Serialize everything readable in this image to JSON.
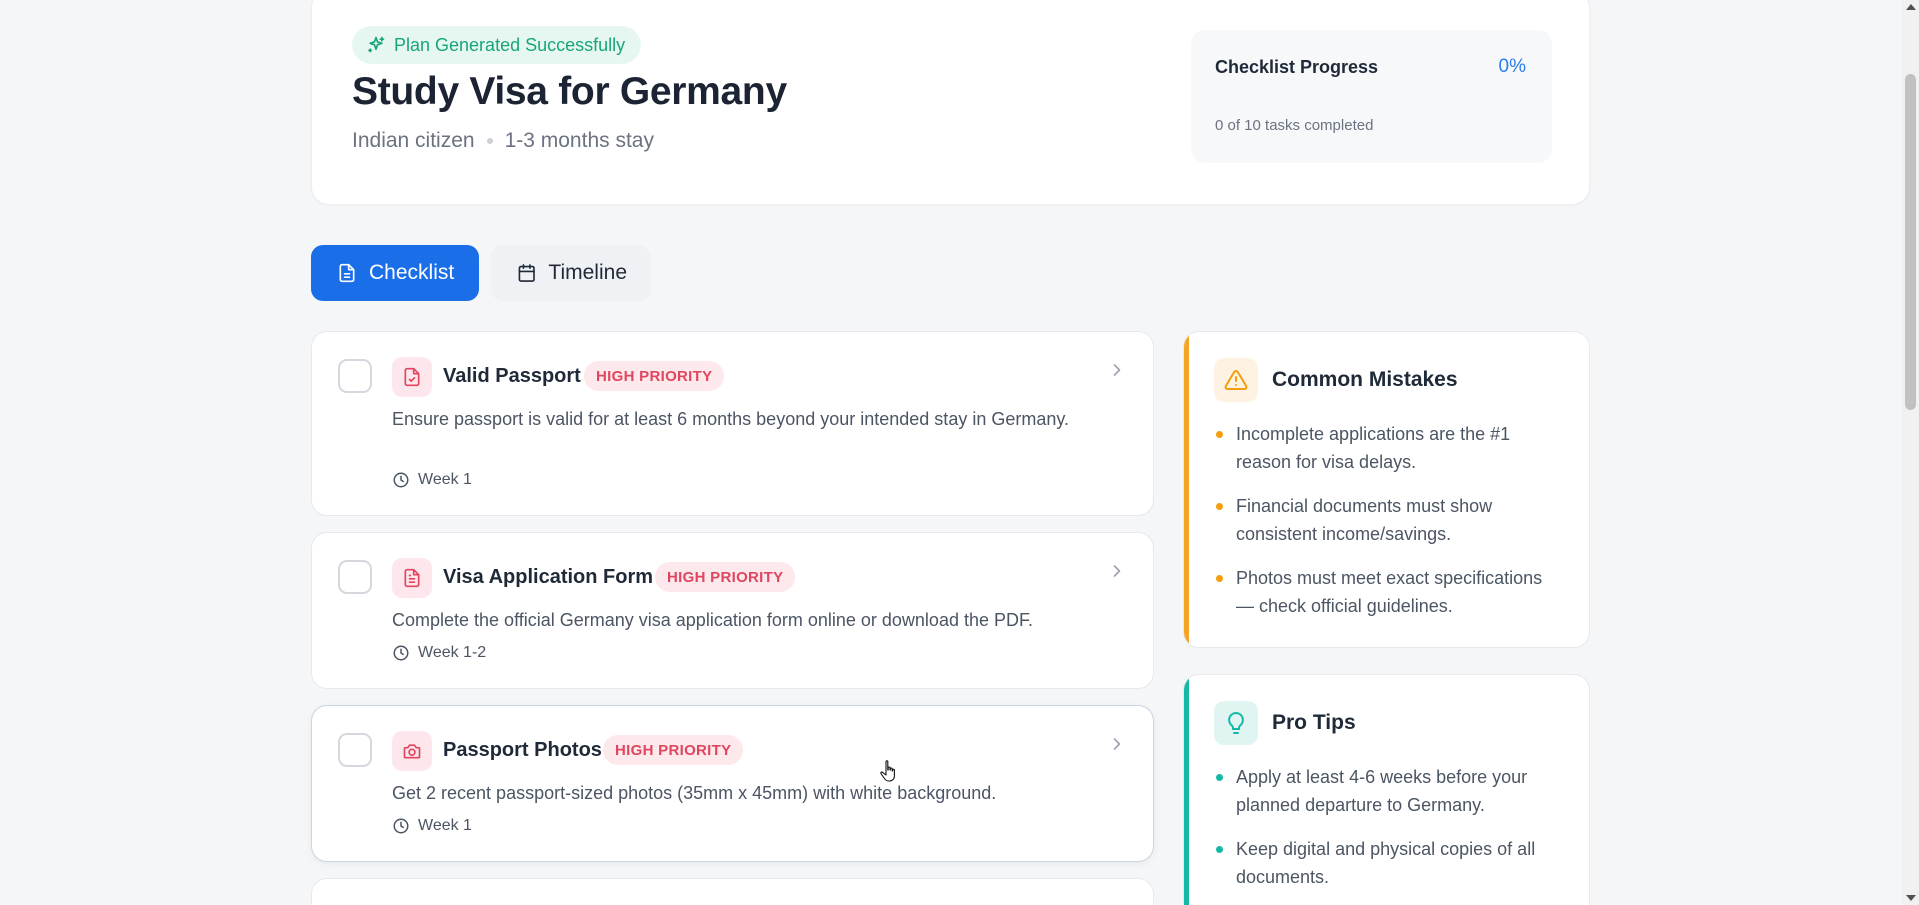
{
  "header": {
    "badge": "Plan Generated Successfully",
    "title": "Study Visa for Germany",
    "citizenship": "Indian citizen",
    "stay": "1-3 months stay",
    "progress": {
      "label": "Checklist Progress",
      "value_text": "0%",
      "percent": 0,
      "summary": "0 of 10 tasks completed"
    }
  },
  "tabs": [
    {
      "label": "Checklist",
      "icon": "document-icon",
      "active": true
    },
    {
      "label": "Timeline",
      "icon": "calendar-icon",
      "active": false
    }
  ],
  "checklist": [
    {
      "title": "Valid Passport",
      "priority": "HIGH PRIORITY",
      "icon": "document-check-icon",
      "description": "Ensure passport is valid for at least 6 months beyond your intended stay in Germany.",
      "time": "Week 1"
    },
    {
      "title": "Visa Application Form",
      "priority": "HIGH PRIORITY",
      "icon": "file-text-icon",
      "description": "Complete the official Germany visa application form online or download the PDF.",
      "time": "Week 1-2"
    },
    {
      "title": "Passport Photos",
      "priority": "HIGH PRIORITY",
      "icon": "camera-icon",
      "description": "Get 2 recent passport-sized photos (35mm x 45mm) with white background.",
      "time": "Week 1"
    }
  ],
  "mistakes": {
    "title": "Common Mistakes",
    "icon": "warning-icon",
    "accent": "#f5a524",
    "items": [
      "Incomplete applications are the #1 reason for visa delays.",
      "Financial documents must show consistent income/savings.",
      "Photos must meet exact specifications — check official guidelines."
    ]
  },
  "tips": {
    "title": "Pro Tips",
    "icon": "lightbulb-icon",
    "accent": "#14b8a6",
    "items": [
      "Apply at least 4-6 weeks before your planned departure to Germany.",
      "Keep digital and physical copies of all documents."
    ]
  },
  "colors": {
    "primary": "#1a6fe8",
    "success": "#18a57a",
    "priority": "#e0465f"
  }
}
